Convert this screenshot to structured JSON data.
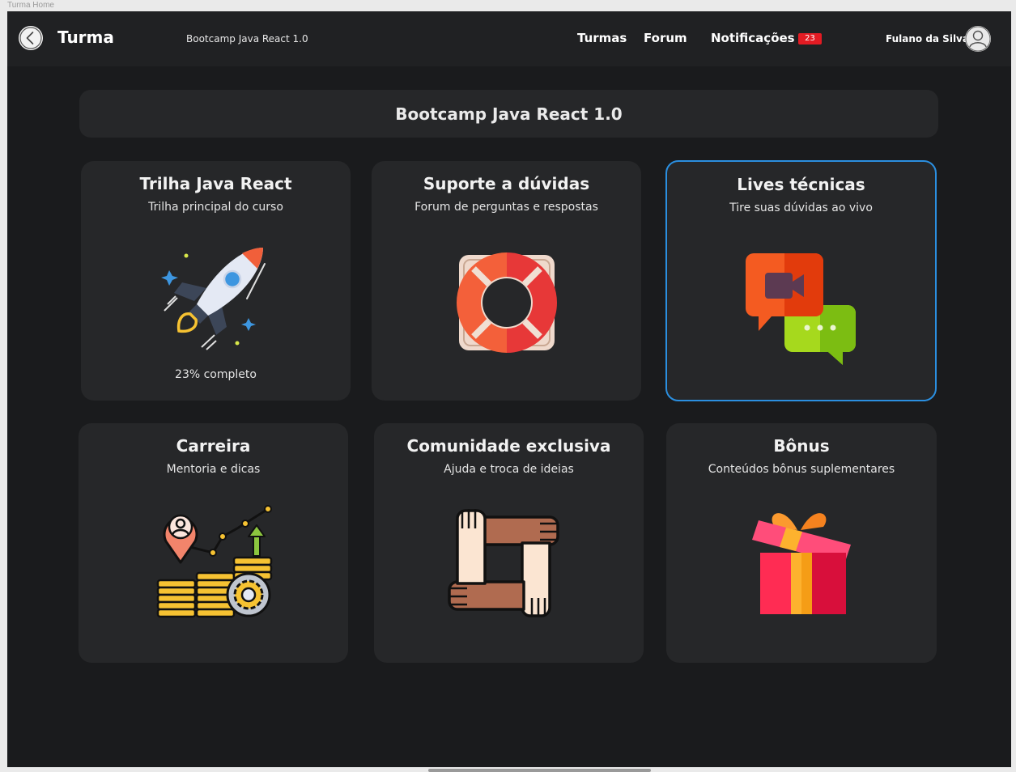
{
  "window": {
    "title": "Turma Home"
  },
  "header": {
    "title": "Turma",
    "course": "Bootcamp Java React 1.0",
    "nav": {
      "turmas": "Turmas",
      "forum": "Forum",
      "notificacoes": "Notificações"
    },
    "notification_count": "23",
    "user_name": "Fulano da Silva"
  },
  "banner": {
    "title": "Bootcamp Java React 1.0"
  },
  "cards": [
    {
      "title": "Trilha Java React",
      "subtitle": "Trilha principal do curso",
      "progress_text": "23% completo",
      "progress_value": 23,
      "icon": "rocket-icon"
    },
    {
      "title": "Suporte a dúvidas",
      "subtitle": "Forum de perguntas e respostas",
      "icon": "lifebuoy-icon"
    },
    {
      "title": "Lives técnicas",
      "subtitle": "Tire suas dúvidas ao vivo",
      "icon": "video-chat-icon",
      "selected": true
    },
    {
      "title": "Carreira",
      "subtitle": "Mentoria e dicas",
      "icon": "career-growth-icon"
    },
    {
      "title": "Comunidade exclusiva",
      "subtitle": "Ajuda e troca de ideias",
      "icon": "teamwork-hands-icon"
    },
    {
      "title": "Bônus",
      "subtitle": "Conteúdos bônus suplementares",
      "icon": "gift-icon"
    }
  ],
  "colors": {
    "background": "#1a1b1d",
    "card": "#262729",
    "selected_border": "#2b8fe0",
    "badge": "#e31b23"
  }
}
